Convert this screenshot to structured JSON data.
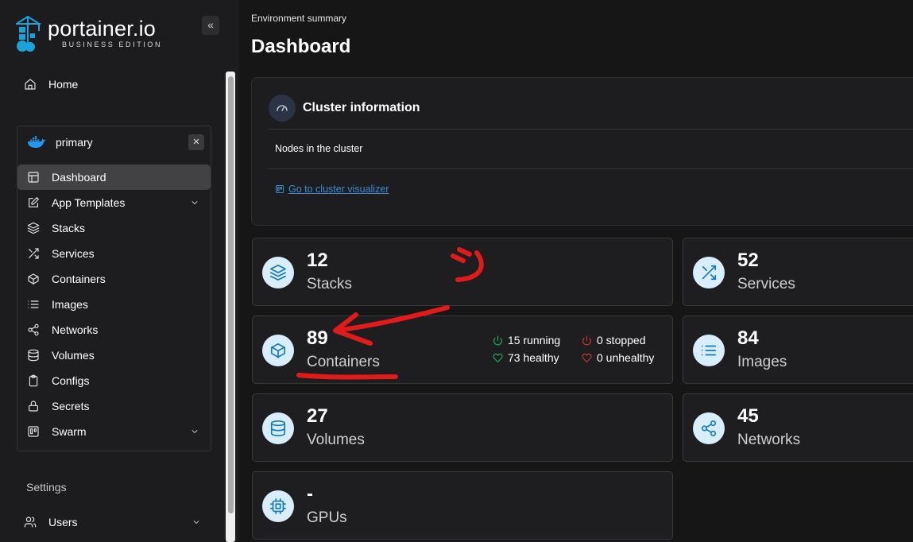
{
  "brand": {
    "name": "portainer.io",
    "edition": "BUSINESS EDITION"
  },
  "sidebar": {
    "home_label": "Home",
    "environment": {
      "name": "primary"
    },
    "menu": [
      {
        "label": "Dashboard",
        "icon": "layout-icon",
        "active": true
      },
      {
        "label": "App Templates",
        "icon": "edit-icon",
        "expandable": true
      },
      {
        "label": "Stacks",
        "icon": "layers-icon"
      },
      {
        "label": "Services",
        "icon": "shuffle-icon"
      },
      {
        "label": "Containers",
        "icon": "box-icon"
      },
      {
        "label": "Images",
        "icon": "list-icon"
      },
      {
        "label": "Networks",
        "icon": "share-icon"
      },
      {
        "label": "Volumes",
        "icon": "database-icon"
      },
      {
        "label": "Configs",
        "icon": "clipboard-icon"
      },
      {
        "label": "Secrets",
        "icon": "lock-icon"
      },
      {
        "label": "Swarm",
        "icon": "trello-icon",
        "expandable": true
      }
    ],
    "settings_title": "Settings",
    "users_label": "Users"
  },
  "main": {
    "breadcrumb": "Environment summary",
    "title": "Dashboard",
    "cluster": {
      "title": "Cluster information",
      "nodes_label": "Nodes in the cluster",
      "link_label": "Go to cluster visualizer"
    },
    "stats": {
      "stacks": {
        "value": "12",
        "label": "Stacks"
      },
      "services": {
        "value": "52",
        "label": "Services"
      },
      "containers": {
        "value": "89",
        "label": "Containers",
        "running": "15 running",
        "stopped": "0 stopped",
        "healthy": "73 healthy",
        "unhealthy": "0 unhealthy"
      },
      "images": {
        "value": "84",
        "label": "Images"
      },
      "volumes": {
        "value": "27",
        "label": "Volumes"
      },
      "networks": {
        "value": "45",
        "label": "Networks"
      },
      "gpus": {
        "value": "-",
        "label": "GPUs"
      }
    }
  },
  "colors": {
    "accent": "#1379bd",
    "icon_bg": "#d9eefc",
    "running": "#27b06a",
    "stopped": "#d23b2f",
    "annotation": "#e11a1a",
    "link": "#3e8bd1"
  }
}
